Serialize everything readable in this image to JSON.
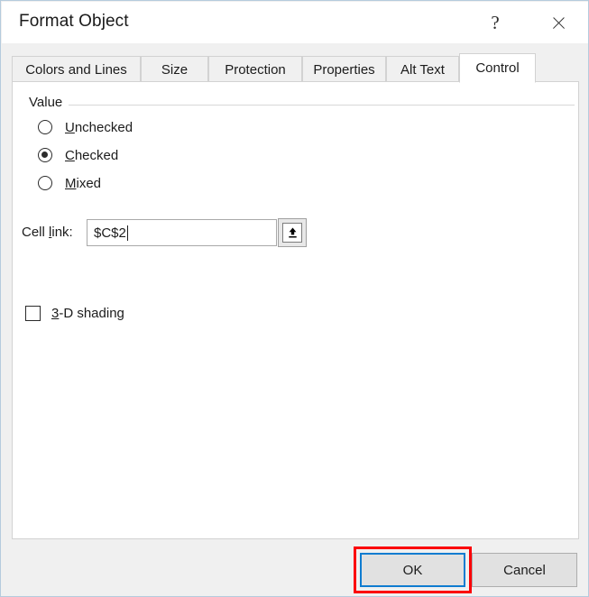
{
  "window": {
    "title": "Format Object",
    "help_icon": "question-mark-icon",
    "close_icon": "close-icon"
  },
  "tabs": [
    {
      "label": "Colors and Lines",
      "selected": false
    },
    {
      "label": "Size",
      "selected": false
    },
    {
      "label": "Protection",
      "selected": false
    },
    {
      "label": "Properties",
      "selected": false
    },
    {
      "label": "Alt Text",
      "selected": false
    },
    {
      "label": "Control",
      "selected": true
    }
  ],
  "control_tab": {
    "group": {
      "label": "Value"
    },
    "radios": [
      {
        "label_prefix": "U",
        "label_rest": "nchecked",
        "checked": false
      },
      {
        "label_prefix": "C",
        "label_rest": "hecked",
        "checked": true
      },
      {
        "label_prefix": "M",
        "label_rest": "ixed",
        "checked": false
      }
    ],
    "cell_link": {
      "label_prefix": "Cell ",
      "label_accel": "l",
      "label_rest": "ink:",
      "value": "$C$2",
      "placeholder": "",
      "range_selector_icon": "collapse-dialog-up-arrow-icon"
    },
    "shading": {
      "label_prefix": "3",
      "label_rest": "-D shading",
      "checked": false
    }
  },
  "footer": {
    "ok_label": "OK",
    "cancel_label": "Cancel"
  },
  "colors": {
    "accent_focus_blue": "#0F7CD0",
    "annotation_red": "#FB0007",
    "dialog_background": "#F0F0F0",
    "panel_background": "#FFFFFF",
    "button_face": "#E1E1E1"
  }
}
